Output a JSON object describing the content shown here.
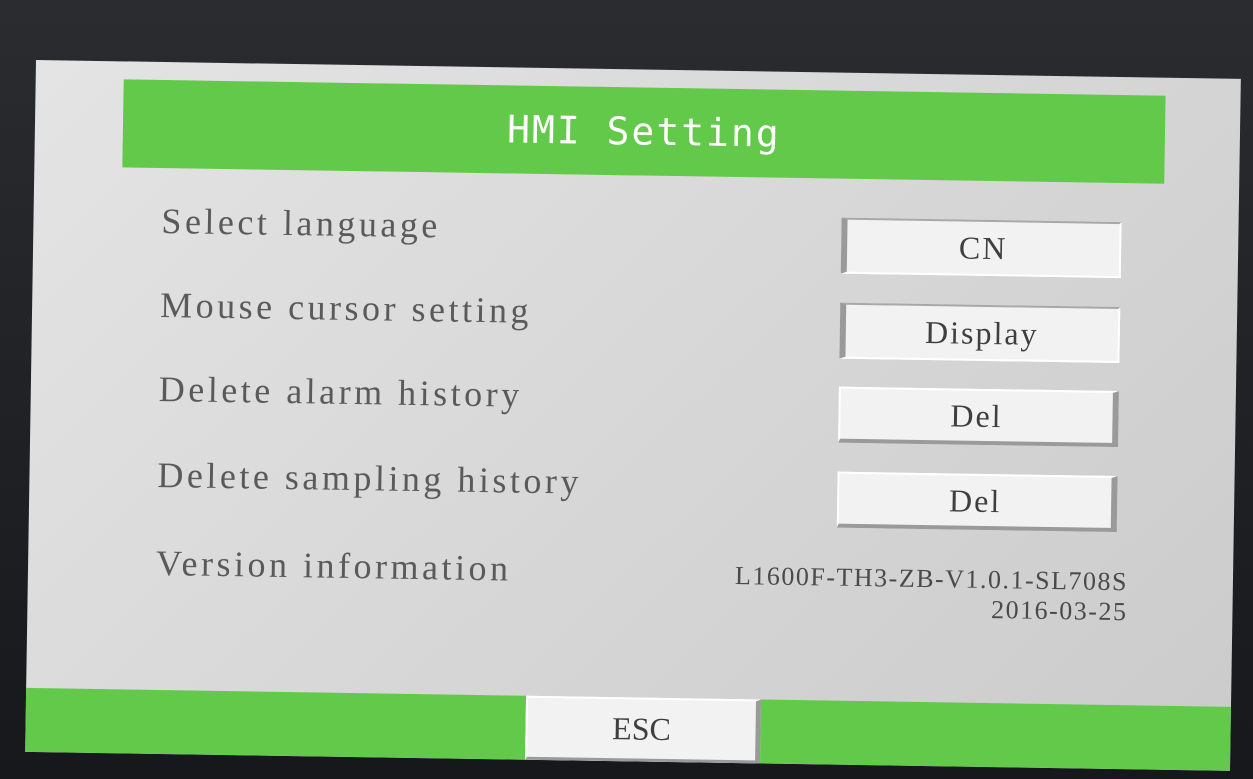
{
  "header": {
    "title": "HMI Setting"
  },
  "settings": [
    {
      "label": "Select language",
      "value": "CN"
    },
    {
      "label": "Mouse cursor setting",
      "value": "Display"
    },
    {
      "label": "Delete alarm history",
      "value": "Del"
    },
    {
      "label": "Delete sampling history",
      "value": "Del"
    }
  ],
  "version": {
    "label": "Version information",
    "code": "L1600F-TH3-ZB-V1.0.1-SL708S",
    "date": "2016-03-25"
  },
  "footer": {
    "esc_label": "ESC"
  },
  "colors": {
    "accent_green": "#63c94a",
    "screen_gray": "#d6d6d6",
    "button_face": "#f2f2f2"
  }
}
